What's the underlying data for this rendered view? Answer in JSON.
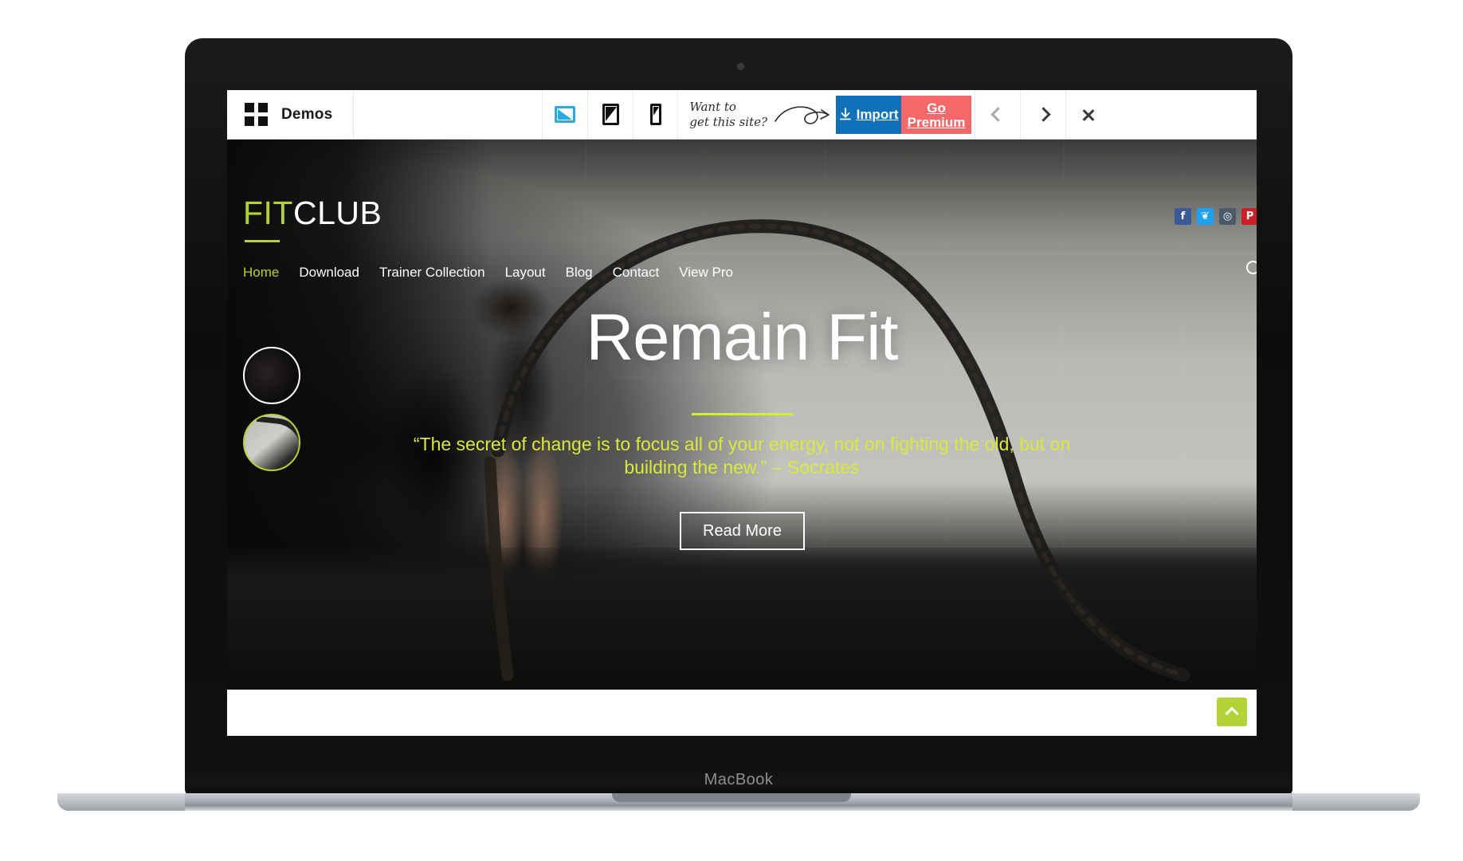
{
  "device": {
    "brand_label": "MacBook"
  },
  "toolbar": {
    "demos_label": "Demos",
    "devices": [
      {
        "name": "desktop-view",
        "icon": "desktop-icon",
        "active": true
      },
      {
        "name": "tablet-view",
        "icon": "tablet-icon",
        "active": false
      },
      {
        "name": "mobile-view",
        "icon": "mobile-icon",
        "active": false
      }
    ],
    "promo_text": "Want to\nget this site?",
    "import_label": "Import",
    "premium_label": "Go Premium",
    "prev_label": "‹",
    "next_label": "›",
    "close_label": "×",
    "colors": {
      "import_bg": "#1070b8",
      "premium_bg": "#f4686a",
      "active_device": "#29abe2"
    }
  },
  "site": {
    "brand": {
      "first": "FIT",
      "second": "CLUB"
    },
    "nav": [
      {
        "label": "Home",
        "active": true
      },
      {
        "label": "Download",
        "active": false
      },
      {
        "label": "Trainer Collection",
        "active": false
      },
      {
        "label": "Layout",
        "active": false
      },
      {
        "label": "Blog",
        "active": false
      },
      {
        "label": "Contact",
        "active": false
      },
      {
        "label": "View Pro",
        "active": false
      }
    ],
    "socials": [
      {
        "name": "facebook",
        "glyph": "f",
        "color": "#3b5998"
      },
      {
        "name": "twitter",
        "glyph": "❦",
        "color": "#1da1f2"
      },
      {
        "name": "instagram",
        "glyph": "◎",
        "color": "#4a5a6a"
      },
      {
        "name": "pinterest",
        "glyph": "P",
        "color": "#cb2027"
      }
    ],
    "hero": {
      "title": "Remain Fit",
      "quote": "“The secret of change is to focus all of your energy, not on fighting the old, but on building the new.” – Socrates",
      "button_label": "Read More",
      "accent_color": "#b2d235",
      "quote_color": "#dbe93a"
    },
    "slider_thumbs": [
      {
        "name": "slide-thumb-1",
        "active": false
      },
      {
        "name": "slide-thumb-2",
        "active": true
      }
    ],
    "to_top_label": "⌃"
  }
}
